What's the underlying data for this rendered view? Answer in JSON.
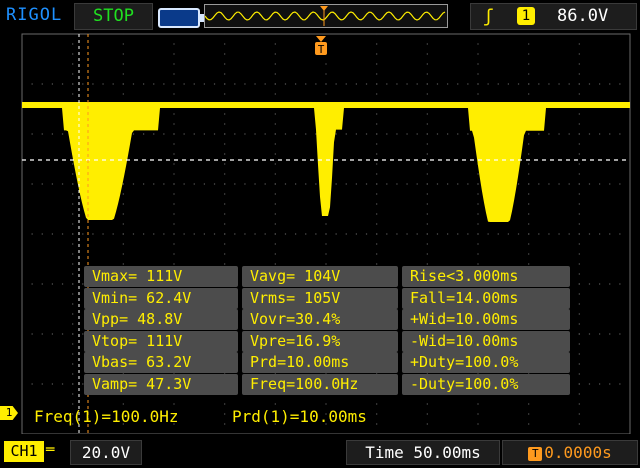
{
  "header": {
    "brand": "RIGOL",
    "run_status": "STOP",
    "trigger": {
      "edge_icon": "rising-edge-icon",
      "channel": "1",
      "level": "86.0V"
    }
  },
  "channel_marker": "1",
  "trigger_marker": "T",
  "measurements": [
    [
      "Vmax= 111V",
      "Vavg= 104V",
      "Rise<3.000ms"
    ],
    [
      "Vmin= 62.4V",
      "Vrms= 105V",
      "Fall=14.00ms"
    ],
    [
      "Vpp= 48.8V",
      "Vovr=30.4%",
      "+Wid=10.00ms"
    ],
    [
      "Vtop= 111V",
      "Vpre=16.9%",
      "-Wid=10.00ms"
    ],
    [
      "Vbas= 63.2V",
      "Prd=10.00ms",
      "+Duty=100.0%"
    ],
    [
      "Vamp= 47.3V",
      "Freq=100.0Hz",
      "-Duty=100.0%"
    ]
  ],
  "counters": {
    "freq": "Freq(1)=100.0Hz",
    "period": "Prd(1)=10.00ms"
  },
  "footer": {
    "channel_label": "CH1",
    "coupling_icon": "dc-coupling-icon",
    "volts_per_div": "20.0V",
    "timebase": "Time 50.00ms",
    "trigger_offset": "0.0000s"
  },
  "colors": {
    "trace": "#ffee00",
    "trigger": "#ff9a1e",
    "brand": "#1e90ff",
    "stop": "#20e020"
  }
}
